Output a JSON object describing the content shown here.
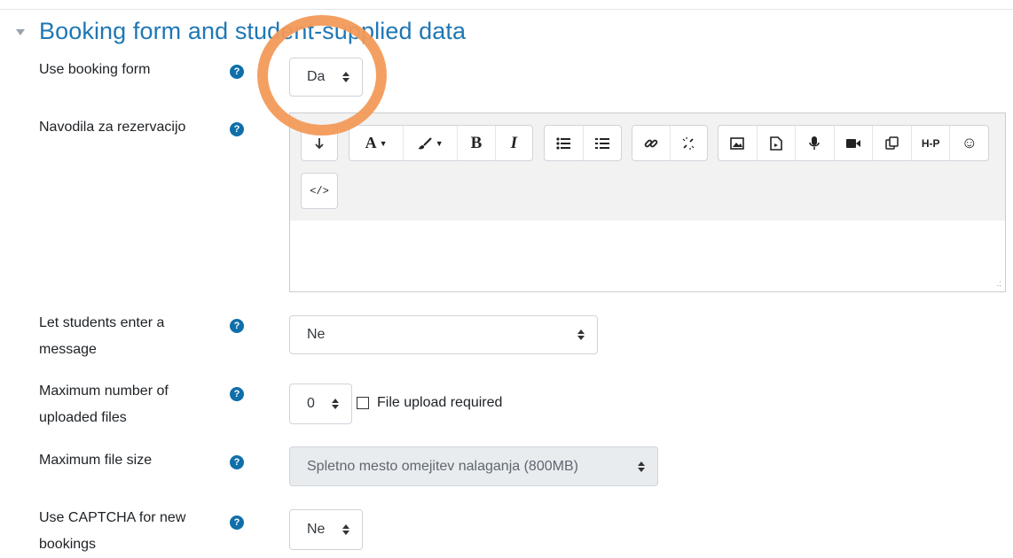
{
  "section": {
    "title": "Booking form and student-supplied data"
  },
  "fields": {
    "use_booking_form": {
      "label": "Use booking form",
      "value": "Da"
    },
    "instructions": {
      "label": "Navodila za rezervacijo"
    },
    "let_students_message": {
      "label": "Let students enter a message",
      "value": "Ne"
    },
    "max_uploaded_files": {
      "label": "Maximum number of uploaded files",
      "value": "0"
    },
    "file_upload_required": {
      "label": "File upload required",
      "checked": false
    },
    "max_file_size": {
      "label": "Maximum file size",
      "value": "Spletno mesto omejitev nalaganja (800MB)"
    },
    "use_captcha": {
      "label": "Use CAPTCHA for new bookings",
      "value": "Ne"
    }
  },
  "editor_toolbar": {
    "font_label": "A",
    "bold": "B",
    "italic": "I",
    "html_label": "</>",
    "h5p_label": "H-P",
    "smiley": "☺"
  },
  "help_glyph": "?",
  "colors": {
    "accent": "#1f77b4",
    "help_icon": "#0f6fa9",
    "highlight_ring": "#f39a5a"
  }
}
